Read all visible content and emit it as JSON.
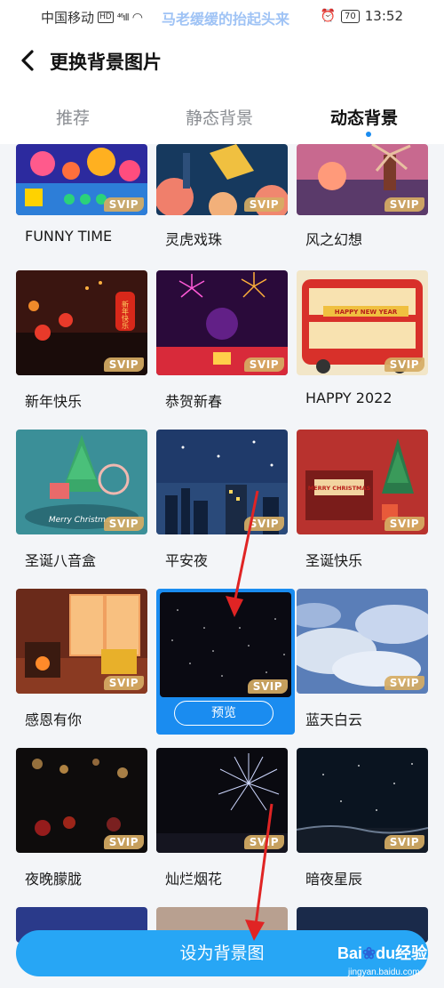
{
  "status": {
    "carrier": "中国移动",
    "hd": "HD",
    "network": "⁴⁶ıll",
    "marquee": "马老缓缓的抬起头来",
    "battery": "70",
    "time": "13:52"
  },
  "header": {
    "title": "更换背景图片"
  },
  "tabs": [
    {
      "label": "推荐"
    },
    {
      "label": "静态背景"
    },
    {
      "label": "动态背景"
    }
  ],
  "items": [
    {
      "name": "FUNNY TIME",
      "badge": "SVIP"
    },
    {
      "name": "灵虎戏珠",
      "badge": "SVIP"
    },
    {
      "name": "风之幻想",
      "badge": "SVIP"
    },
    {
      "name": "新年快乐",
      "badge": "SVIP"
    },
    {
      "name": "恭贺新春",
      "badge": "SVIP"
    },
    {
      "name": "HAPPY 2022",
      "badge": "SVIP"
    },
    {
      "name": "圣诞八音盒",
      "badge": "SVIP"
    },
    {
      "name": "平安夜",
      "badge": "SVIP"
    },
    {
      "name": "圣诞快乐",
      "badge": "SVIP"
    },
    {
      "name": "感恩有你",
      "badge": "SVIP"
    },
    {
      "name": "",
      "badge": "SVIP",
      "preview": "预览"
    },
    {
      "name": "蓝天白云",
      "badge": "SVIP"
    },
    {
      "name": "夜晚朦胧",
      "badge": "SVIP"
    },
    {
      "name": "灿烂烟花",
      "badge": "SVIP"
    },
    {
      "name": "暗夜星辰",
      "badge": "SVIP"
    }
  ],
  "thumb_art": {
    "new_year": "新年快乐",
    "happy_new_year": "HAPPY NEW YEAR",
    "merry_christmas": "Merry Christmas",
    "merry_christmas_2": "MERRY CHRISTMAS"
  },
  "bottom": {
    "set_label": "设为背景图"
  },
  "watermark": {
    "brand_a": "Bai",
    "brand_b": "du",
    "brand_c": "经验",
    "site": "jingyan.baidu.com"
  }
}
